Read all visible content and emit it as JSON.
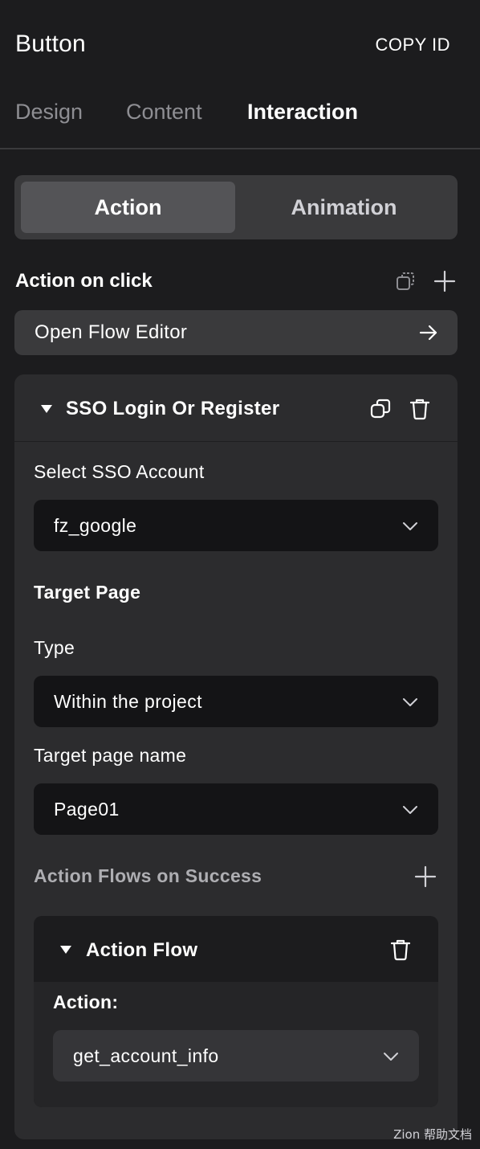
{
  "header": {
    "title": "Button",
    "copy_id_label": "COPY ID"
  },
  "tabs": [
    {
      "label": "Design",
      "active": false
    },
    {
      "label": "Content",
      "active": false
    },
    {
      "label": "Interaction",
      "active": true
    }
  ],
  "segment": {
    "action_label": "Action",
    "animation_label": "Animation",
    "selected": "Action"
  },
  "action_section": {
    "title": "Action on click",
    "icons": [
      "copy-stack-icon",
      "plus-icon"
    ],
    "flow_editor_label": "Open Flow Editor",
    "flow_editor_icon": "arrow-right-icon"
  },
  "sso": {
    "title": "SSO Login Or Register",
    "icons": [
      "duplicate-icon",
      "trash-icon"
    ],
    "account_label": "Select SSO Account",
    "account_value": "fz_google",
    "target_page_heading": "Target Page",
    "type_label": "Type",
    "type_value": "Within the project",
    "page_name_label": "Target page name",
    "page_name_value": "Page01",
    "flows_label": "Action Flows on Success",
    "action_flow": {
      "title": "Action Flow",
      "action_label": "Action:",
      "action_value": "get_account_info"
    }
  },
  "watermark": "Zion 帮助文档",
  "colors": {
    "background": "#1c1c1e",
    "card": "#2c2c2e",
    "segment_bg": "#3a3a3c",
    "segment_active": "#545457",
    "select_bg": "#141416",
    "muted_text": "#8e8e93"
  }
}
